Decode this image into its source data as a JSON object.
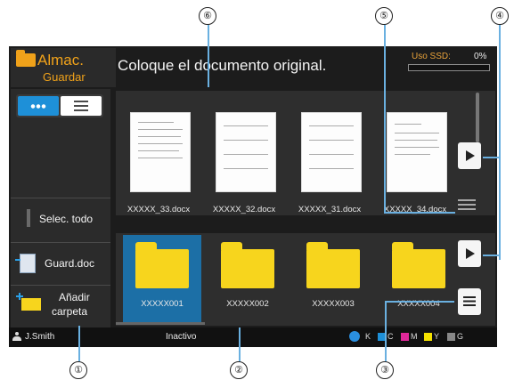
{
  "header": {
    "mode_title": "Almac.",
    "mode_subtitle": "Guardar",
    "message": "Coloque el documento original.",
    "ssd_label": "Uso SSD:",
    "ssd_value": "0%",
    "ssd_usage_fraction": 0.0
  },
  "sidebar": {
    "select_all_label": "Selec. todo",
    "save_doc_label": "Guard.doc",
    "add_folder_label_line1": "Añadir",
    "add_folder_label_line2": "carpeta"
  },
  "documents": [
    {
      "name": "XXXXX_33.docx"
    },
    {
      "name": "XXXXX_32.docx"
    },
    {
      "name": "XXXXX_31.docx"
    },
    {
      "name": "XXXXX_34.docx"
    }
  ],
  "folders": [
    {
      "name": "XXXXX001",
      "selected": true
    },
    {
      "name": "XXXXX002",
      "selected": false
    },
    {
      "name": "XXXXX003",
      "selected": false
    },
    {
      "name": "XXXXX004",
      "selected": false
    }
  ],
  "status": {
    "user": "J.Smith",
    "state": "Inactivo",
    "inks": [
      "K",
      "C",
      "M",
      "Y",
      "G"
    ]
  },
  "colors": {
    "accent": "#f0a21a",
    "selection": "#1c6fa6",
    "toggle_active": "#1e90d8",
    "folder": "#f7d51d",
    "callout_line": "#6ab0e0"
  },
  "callouts": [
    "①",
    "②",
    "③",
    "④",
    "⑤",
    "⑥"
  ]
}
